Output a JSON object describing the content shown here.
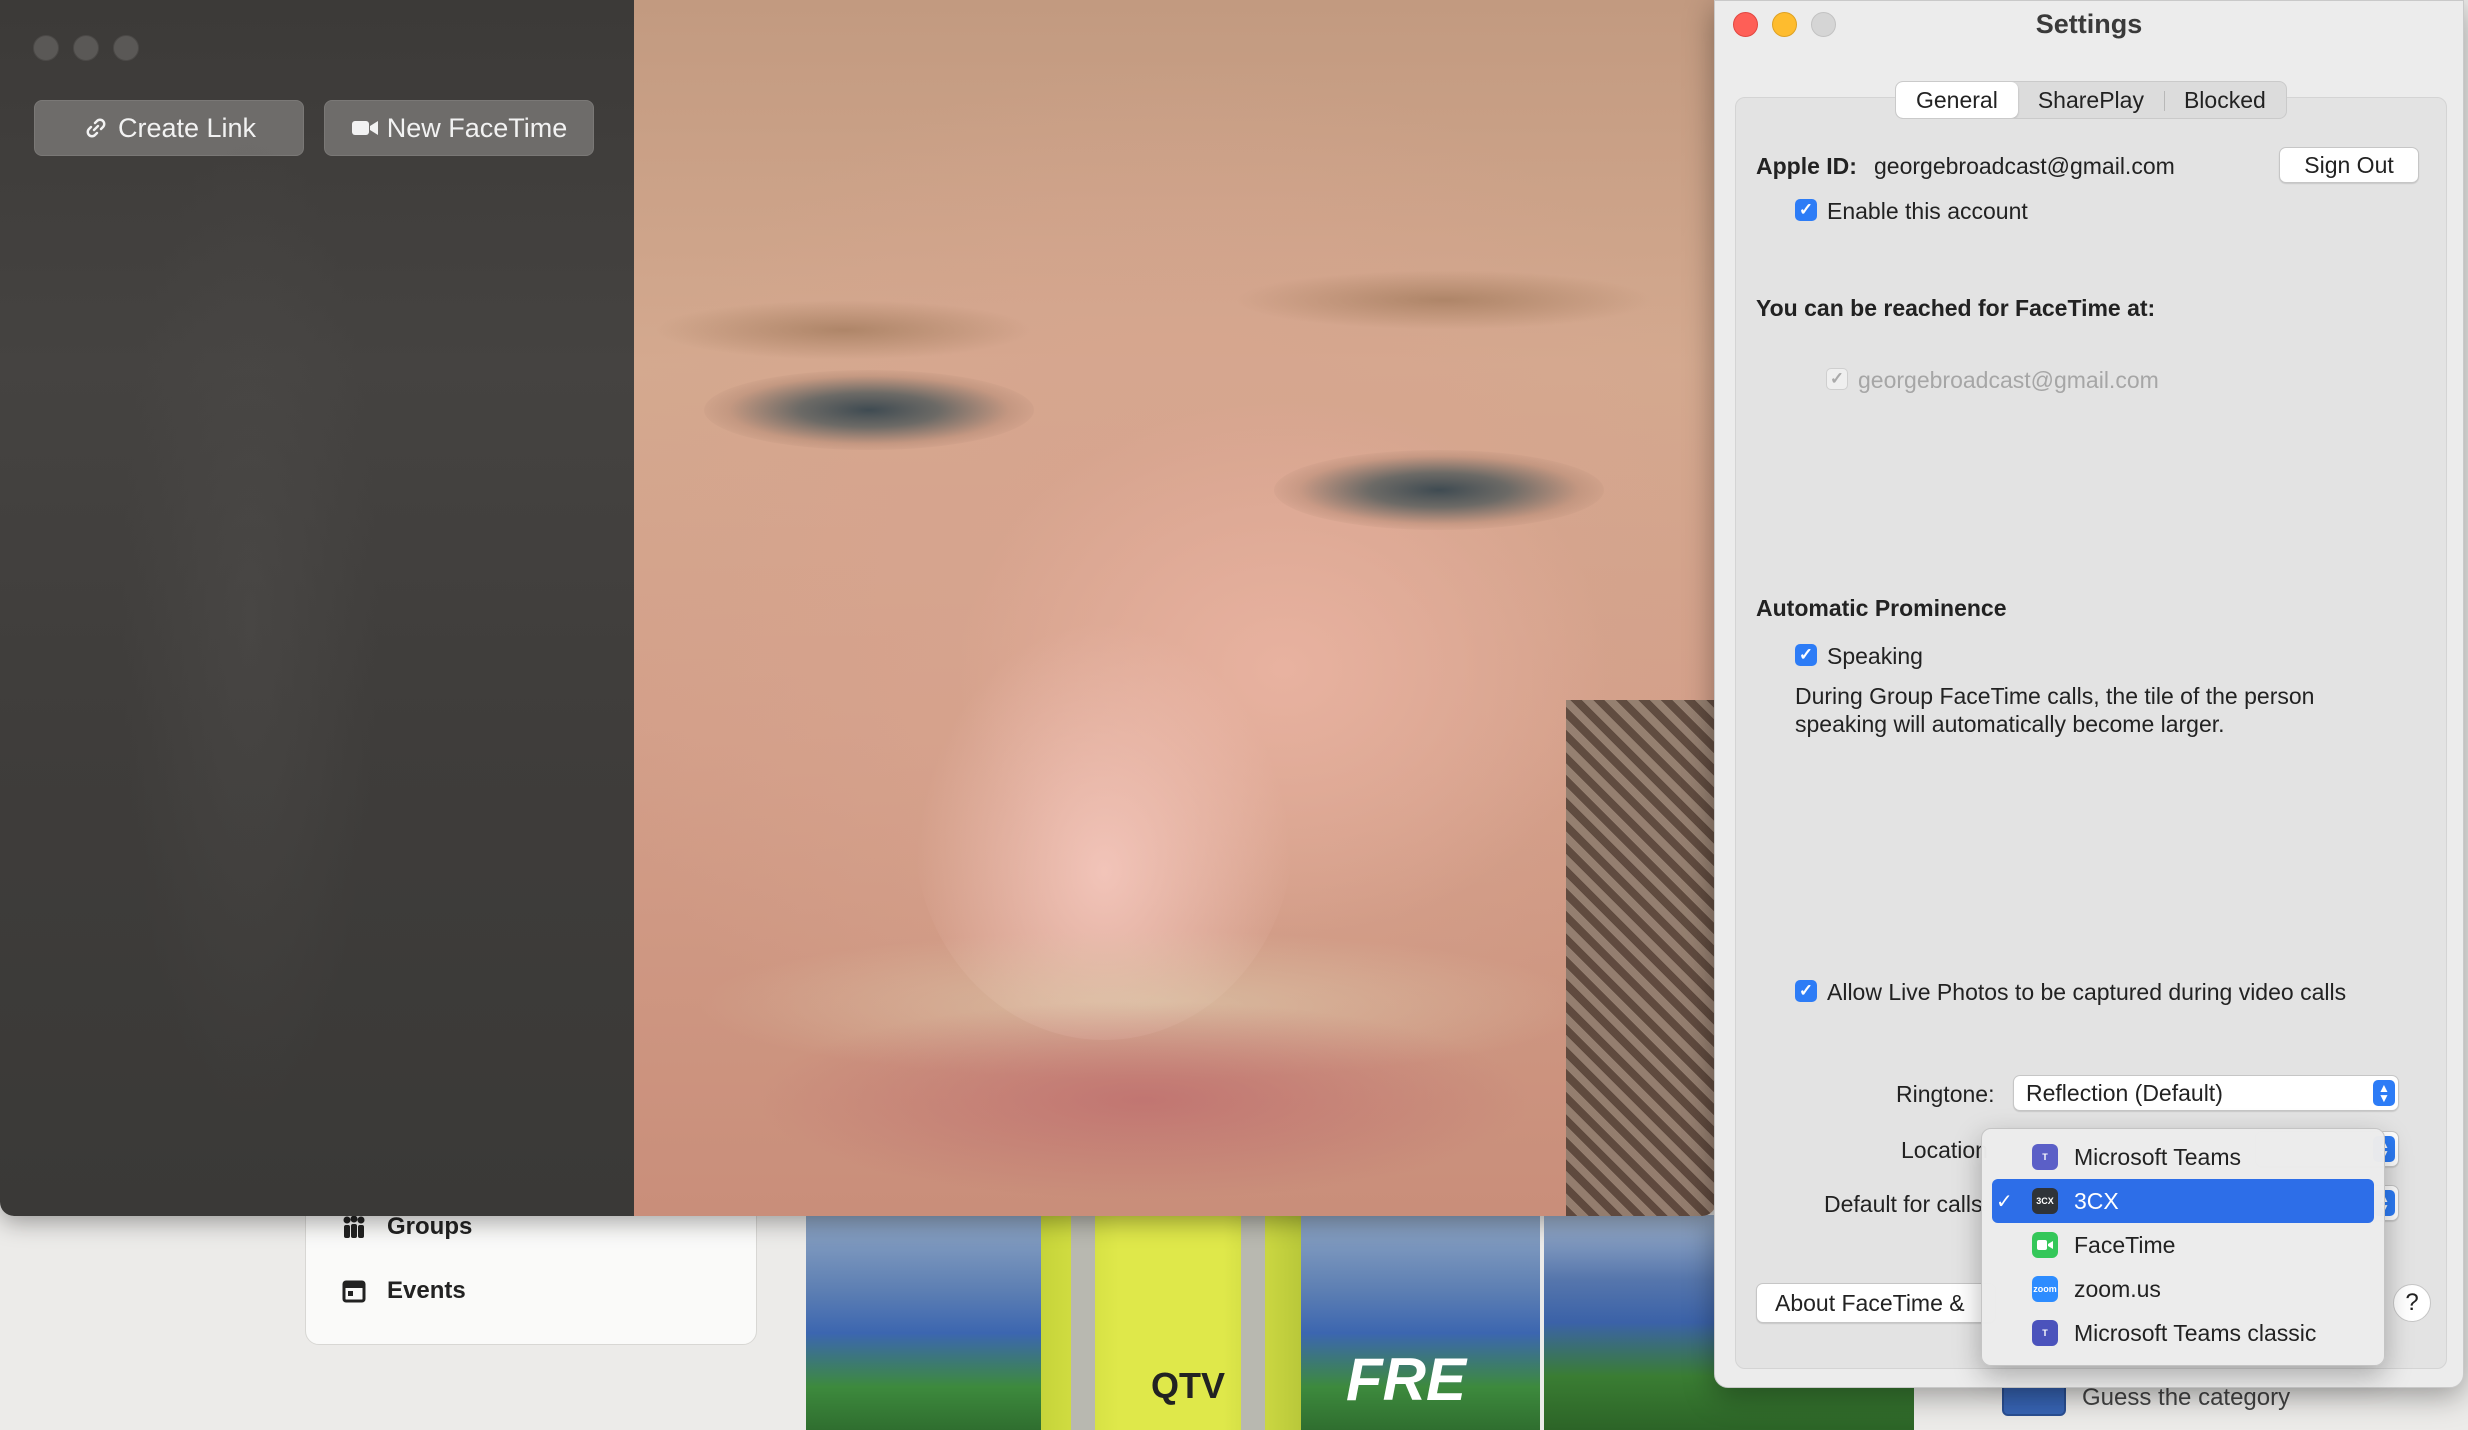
{
  "background": {
    "sidebar_items": [
      {
        "label": "Groups",
        "icon": "groups-icon"
      },
      {
        "label": "Events",
        "icon": "calendar-icon"
      }
    ],
    "photo_vest_text": "QTV",
    "photo_banner_text": "FRE",
    "guess_label": "Guess the category"
  },
  "facetime": {
    "create_link_label": "Create Link",
    "new_facetime_label": "New FaceTime"
  },
  "settings": {
    "title": "Settings",
    "tabs": [
      {
        "label": "General",
        "active": true
      },
      {
        "label": "SharePlay",
        "active": false
      },
      {
        "label": "Blocked",
        "active": false
      }
    ],
    "apple_id_label": "Apple ID:",
    "apple_id_value": "georgebroadcast@gmail.com",
    "sign_out_label": "Sign Out",
    "enable_account_label": "Enable this account",
    "reached_heading": "You can be reached for FaceTime at:",
    "reached_address": "georgebroadcast@gmail.com",
    "prominence_heading": "Automatic Prominence",
    "speaking_label": "Speaking",
    "speaking_desc_1": "During Group FaceTime calls, the tile of the person",
    "speaking_desc_2": "speaking will automatically become larger.",
    "live_photos_label": "Allow Live Photos to be captured during video calls",
    "ringtone_label": "Ringtone:",
    "ringtone_value": "Reflection (Default)",
    "location_label": "Location",
    "default_calls_label": "Default for calls",
    "about_button_label": "About FaceTime &",
    "help_label": "?"
  },
  "menu": {
    "items": [
      {
        "label": "Microsoft Teams",
        "icon": "teams-icon",
        "selected": false
      },
      {
        "label": "3CX",
        "icon": "3cx-icon",
        "selected": true
      },
      {
        "label": "FaceTime",
        "icon": "facetime-icon",
        "selected": false
      },
      {
        "label": "zoom.us",
        "icon": "zoom-icon",
        "selected": false
      },
      {
        "label": "Microsoft Teams classic",
        "icon": "teams-classic-icon",
        "selected": false
      }
    ],
    "check_glyph": "✓"
  },
  "colors": {
    "accent": "#2d7cf6",
    "menu_selection": "#2d6ee8",
    "close": "#fe5f57",
    "minimize": "#febc2e"
  }
}
